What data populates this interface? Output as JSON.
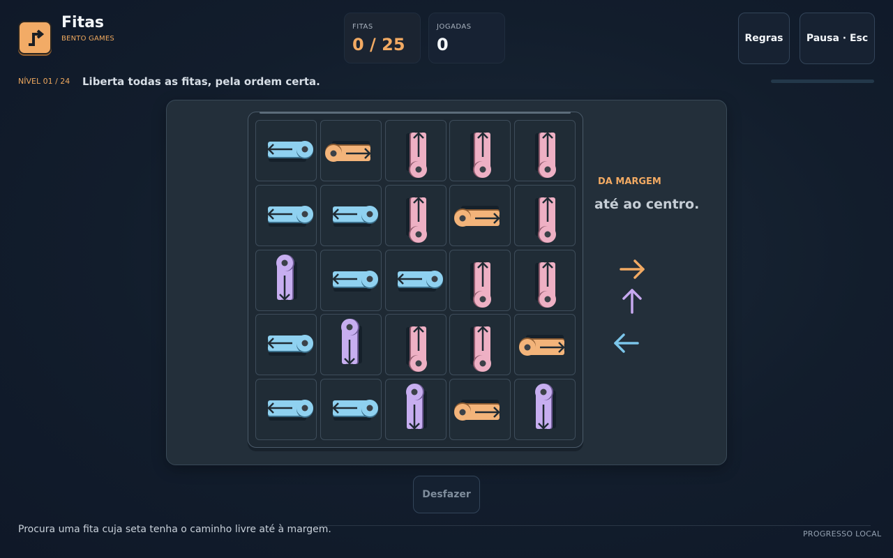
{
  "app": {
    "title": "Fitas",
    "subtitle": "BENTO GAMES",
    "logo_icon": "turn-arrow-icon"
  },
  "stats": {
    "fitas": {
      "label": "FITAS",
      "value": "0 / 25"
    },
    "jogadas": {
      "label": "JOGADAS",
      "value": "0"
    }
  },
  "buttons": {
    "rules": "Regras",
    "pause": "Pausa · Esc",
    "undo": "Desfazer"
  },
  "level": {
    "label": "NÍVEL 01 / 24",
    "instruction": "Liberta todas as fitas, pela ordem certa.",
    "progress": 0
  },
  "hint": {
    "title": "DA MARGEM",
    "text": "até ao centro.",
    "arrows": [
      {
        "dir": "right",
        "color": "#f2aa63"
      },
      {
        "dir": "up",
        "color": "#c7a9f0"
      },
      {
        "dir": "left",
        "color": "#7cc6ea"
      }
    ]
  },
  "footer": {
    "hint": "Procura uma fita cuja seta tenha o caminho livre até à margem.",
    "right": "PROGRESSO LOCAL"
  },
  "colors": {
    "blue": "#8fd1f0",
    "orange": "#f3b47a",
    "pink": "#eeb0c4",
    "purple": "#c7aef0"
  },
  "board": {
    "rows": 5,
    "cols": 5,
    "cells": [
      [
        {
          "color": "blue",
          "dir": "left"
        },
        {
          "color": "orange",
          "dir": "right"
        },
        {
          "color": "pink",
          "dir": "up"
        },
        {
          "color": "pink",
          "dir": "up"
        },
        {
          "color": "pink",
          "dir": "up"
        }
      ],
      [
        {
          "color": "blue",
          "dir": "left"
        },
        {
          "color": "blue",
          "dir": "left"
        },
        {
          "color": "pink",
          "dir": "up"
        },
        {
          "color": "orange",
          "dir": "right"
        },
        {
          "color": "pink",
          "dir": "up"
        }
      ],
      [
        {
          "color": "purple",
          "dir": "down"
        },
        {
          "color": "blue",
          "dir": "left"
        },
        {
          "color": "blue",
          "dir": "left"
        },
        {
          "color": "pink",
          "dir": "up"
        },
        {
          "color": "pink",
          "dir": "up"
        }
      ],
      [
        {
          "color": "blue",
          "dir": "left"
        },
        {
          "color": "purple",
          "dir": "down"
        },
        {
          "color": "pink",
          "dir": "up"
        },
        {
          "color": "pink",
          "dir": "up"
        },
        {
          "color": "orange",
          "dir": "right"
        }
      ],
      [
        {
          "color": "blue",
          "dir": "left"
        },
        {
          "color": "blue",
          "dir": "left"
        },
        {
          "color": "purple",
          "dir": "down"
        },
        {
          "color": "orange",
          "dir": "right"
        },
        {
          "color": "purple",
          "dir": "down"
        }
      ]
    ]
  }
}
